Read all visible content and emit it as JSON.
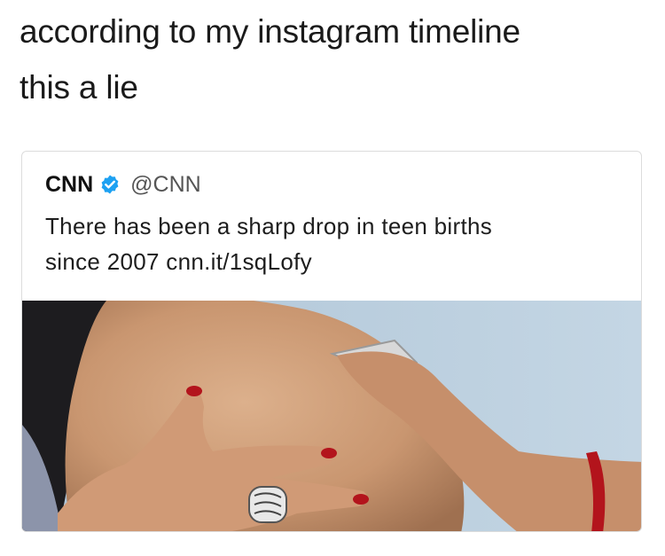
{
  "caption": {
    "line1": "according to my instagram timeline",
    "line2": "this a lie"
  },
  "tweet": {
    "author_name": "CNN",
    "verified_icon": "verified-badge-icon",
    "handle": "@CNN",
    "text_line1": "There has been a sharp drop in teen births",
    "text_line2": "since 2007 cnn.it/1sqLofy",
    "photo_description_icon": "pregnant-belly-photo"
  },
  "colors": {
    "verified_blue": "#1da1f2",
    "photo_background": "#b7ccdd",
    "skin": "#d4a37f",
    "nail_polish": "#b3141c",
    "shirt": "#1d1c1f"
  }
}
